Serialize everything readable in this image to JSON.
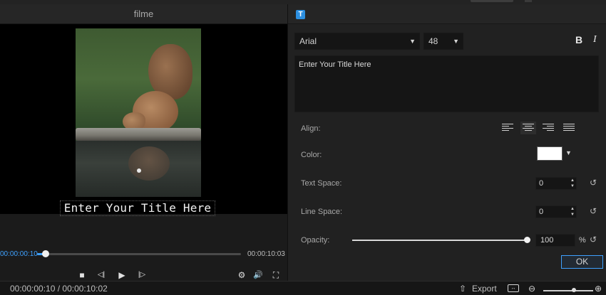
{
  "player": {
    "title": "filme",
    "overlay_text": "Enter Your Title Here",
    "current_time": "00:00:00:10",
    "end_time": "00:00:10:03",
    "progress": 0.02,
    "icons": {
      "stop": "■",
      "prev_frame": "◁|",
      "play": "▶",
      "next_frame": "|▷",
      "settings": "⚙",
      "volume": "🔊",
      "fullscreen": "⛶"
    }
  },
  "editor": {
    "font": "Arial",
    "font_size": "48",
    "bold": "B",
    "italic": "I",
    "text": "Enter Your Title Here",
    "align_label": "Align:",
    "color_label": "Color:",
    "color_value": "#ffffff",
    "text_space_label": "Text Space:",
    "text_space": "0",
    "line_space_label": "Line Space:",
    "line_space": "0",
    "opacity_label": "Opacity:",
    "opacity": "100",
    "opacity_unit": "%",
    "ok": "OK",
    "badge": "T"
  },
  "status": {
    "timecode": "00:00:00:10 / 00:00:10:02",
    "export": "Export",
    "export_icon": "⇧",
    "zoom_out": "⊖",
    "zoom_in": "⊕"
  },
  "colors": {
    "accent": "#3ea1ff",
    "badge": "#2c8fe0"
  }
}
